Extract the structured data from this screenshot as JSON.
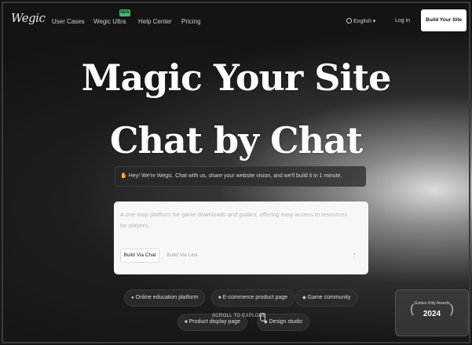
{
  "nav": {
    "logo": "Wegic",
    "links": [
      "User Cases",
      "Wegic Ultra",
      "Help Center",
      "Pricing"
    ],
    "new_badge": "NEW",
    "language": "English",
    "login": "Log in",
    "build_button": "Build Your Site"
  },
  "hero": {
    "line1": "Magic Your Site",
    "line2": "Chat by Chat"
  },
  "greeting": "Hey! We're Wegic. Chat with us, share your website vision, and we'll build it in 1 minute.",
  "input_card": {
    "placeholder": "A one-stop platform for game downloads and guides, offering easy access to resources for players.",
    "tab_chat": "Build Via Chat",
    "tab_link": "Build Via Link"
  },
  "chips": [
    "Online education platform",
    "E-commerce product page",
    "Game community",
    "Product display page",
    "Design studio"
  ],
  "scroll_hint": "SCROLL TO EXPLORE",
  "award": {
    "title": "Golden Kitty Awards",
    "year": "2024"
  },
  "icons": {
    "globe": "globe-icon",
    "wave": "wave-icon",
    "send": "arrow-up-icon",
    "mouse": "mouse-icon",
    "laurel": "laurel-icon"
  },
  "colors": {
    "background": "#141414",
    "badge": "#49b96a",
    "card": "#f7f7f7",
    "button": "#ffffff"
  }
}
